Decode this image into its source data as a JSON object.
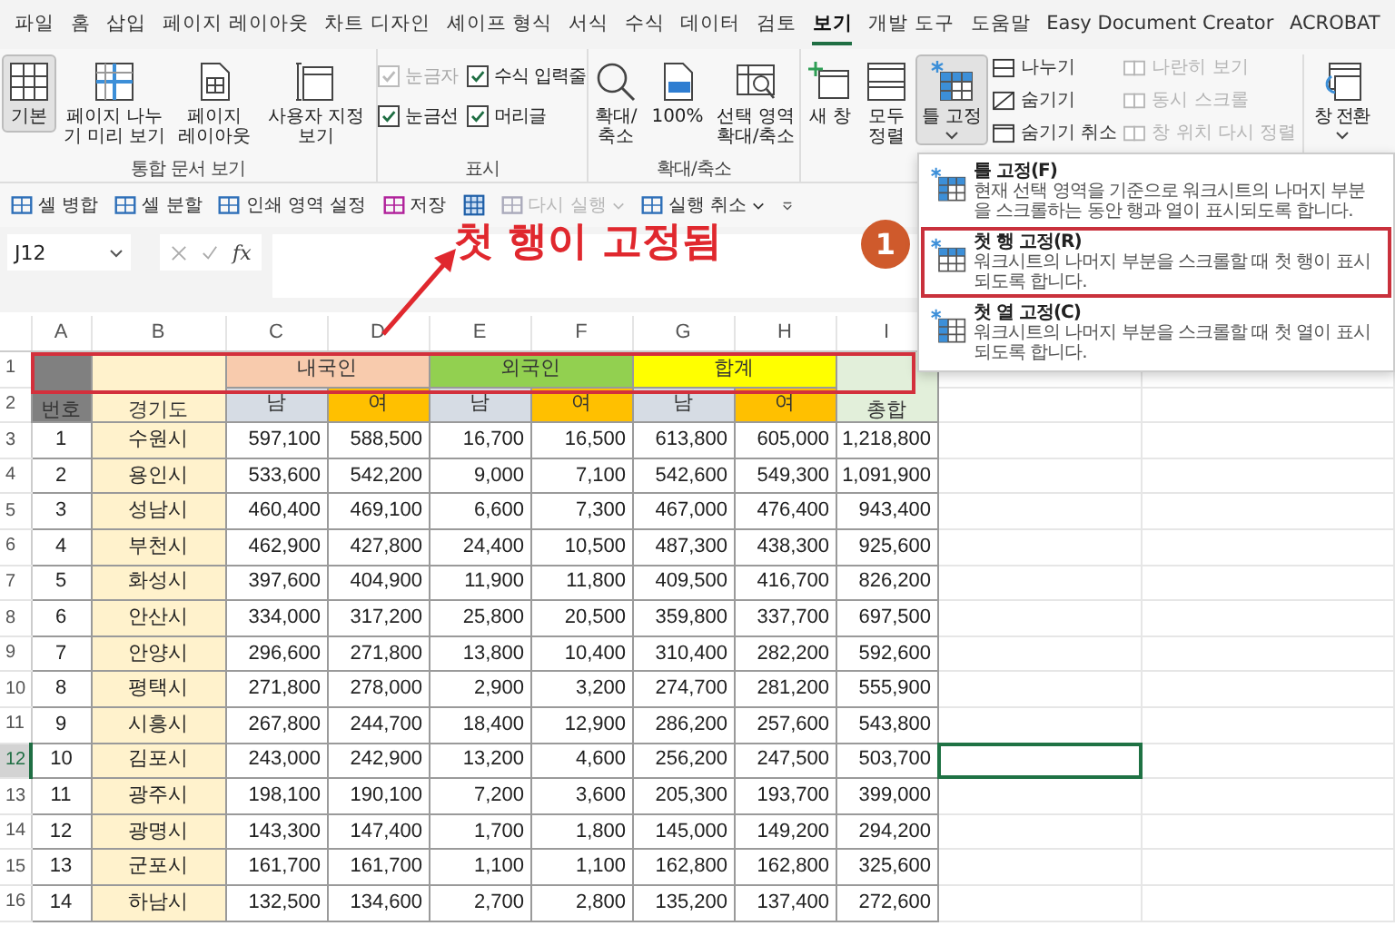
{
  "menu_tabs": [
    {
      "label": "파일",
      "selected": false
    },
    {
      "label": "홈",
      "selected": false
    },
    {
      "label": "삽입",
      "selected": false
    },
    {
      "label": "페이지 레이아웃",
      "selected": false
    },
    {
      "label": "차트 디자인",
      "selected": false
    },
    {
      "label": "셰이프 형식",
      "selected": false
    },
    {
      "label": "서식",
      "selected": false
    },
    {
      "label": "수식",
      "selected": false
    },
    {
      "label": "데이터",
      "selected": false
    },
    {
      "label": "검토",
      "selected": false
    },
    {
      "label": "보기",
      "selected": true
    },
    {
      "label": "개발 도구",
      "selected": false
    },
    {
      "label": "도움말",
      "selected": false
    },
    {
      "label": "Easy Document Creator",
      "selected": false
    },
    {
      "label": "ACROBAT",
      "selected": false
    }
  ],
  "ribbon": {
    "workbook_views": {
      "label": "통합 문서 보기",
      "buttons": [
        {
          "label": "기본",
          "selected": true
        },
        {
          "label": "페이지 나누기 미리 보기",
          "selected": false
        },
        {
          "label": "페이지 레이아웃",
          "selected": false
        },
        {
          "label": "사용자 지정 보기",
          "selected": false
        }
      ]
    },
    "show": {
      "label": "표시",
      "checkboxes": [
        {
          "label": "눈금자",
          "checked": true,
          "disabled": true
        },
        {
          "label": "수식 입력줄",
          "checked": true,
          "disabled": false
        },
        {
          "label": "눈금선",
          "checked": true,
          "disabled": false
        },
        {
          "label": "머리글",
          "checked": true,
          "disabled": false
        }
      ]
    },
    "zoom": {
      "label": "확대/축소",
      "buttons": [
        {
          "label": "확대/축소"
        },
        {
          "label": "100%"
        },
        {
          "label": "선택 영역 확대/축소"
        }
      ]
    },
    "window": {
      "large_buttons": [
        {
          "label": "새 창",
          "pressed": false,
          "dropdown": false
        },
        {
          "label": "모두 정렬",
          "pressed": false,
          "dropdown": false
        },
        {
          "label": "틀 고정",
          "pressed": true,
          "dropdown": true
        }
      ],
      "small_buttons": [
        {
          "label": "나누기",
          "disabled": false
        },
        {
          "label": "숨기기",
          "disabled": false
        },
        {
          "label": "숨기기 취소",
          "disabled": false
        },
        {
          "label": "나란히 보기",
          "disabled": true
        },
        {
          "label": "동시 스크롤",
          "disabled": true
        },
        {
          "label": "창 위치 다시 정렬",
          "disabled": true
        }
      ],
      "switch_button": {
        "label": "창 전환",
        "dropdown": true
      }
    }
  },
  "quick_access": [
    {
      "kind": "labeled",
      "label": "셀 병합",
      "disabled": false,
      "dropdown": false
    },
    {
      "kind": "labeled",
      "label": "셀 분할",
      "disabled": false,
      "dropdown": false
    },
    {
      "kind": "labeled",
      "label": "인쇄 영역 설정",
      "disabled": false,
      "dropdown": false
    },
    {
      "kind": "labeled",
      "label": "저장",
      "disabled": false,
      "dropdown": false
    },
    {
      "kind": "icon"
    },
    {
      "kind": "labeled",
      "label": "다시 실행",
      "disabled": true,
      "dropdown": true
    },
    {
      "kind": "labeled",
      "label": "실행 취소",
      "disabled": false,
      "dropdown": true
    },
    {
      "kind": "customize"
    }
  ],
  "formula_bar": {
    "name_box": "J12",
    "function_label": "fx"
  },
  "sheet": {
    "columns": [
      "A",
      "B",
      "C",
      "D",
      "E",
      "F",
      "G",
      "H",
      "I"
    ],
    "row_numbers": [
      {
        "label": "1",
        "selected": false
      },
      {
        "label": "2",
        "selected": false
      },
      {
        "label": "3",
        "selected": false
      },
      {
        "label": "4",
        "selected": false
      },
      {
        "label": "5",
        "selected": false
      },
      {
        "label": "6",
        "selected": false
      },
      {
        "label": "7",
        "selected": false
      },
      {
        "label": "8",
        "selected": false
      },
      {
        "label": "9",
        "selected": false
      },
      {
        "label": "10",
        "selected": false
      },
      {
        "label": "11",
        "selected": false
      },
      {
        "label": "12",
        "selected": true
      },
      {
        "label": "13",
        "selected": false
      },
      {
        "label": "14",
        "selected": false
      },
      {
        "label": "15",
        "selected": false
      },
      {
        "label": "16",
        "selected": false
      }
    ],
    "header": [
      {
        "kind": "merged",
        "label": "번호",
        "color": "#808080"
      },
      {
        "kind": "merged",
        "label": "경기도",
        "color": "#fff2cc"
      },
      {
        "kind": "split",
        "label": "내국인",
        "color": "#f8cbad",
        "subs": [
          {
            "label": "남",
            "color": "#d6dce4"
          },
          {
            "label": "여",
            "color": "#ffc000"
          }
        ]
      },
      {
        "kind": "split",
        "label": "외국인",
        "color": "#92d050",
        "subs": [
          {
            "label": "남",
            "color": "#d6dce4"
          },
          {
            "label": "여",
            "color": "#ffc000"
          }
        ]
      },
      {
        "kind": "split",
        "label": "합계",
        "color": "#ffff00",
        "subs": [
          {
            "label": "남",
            "color": "#d6dce4"
          },
          {
            "label": "여",
            "color": "#ffc000"
          }
        ]
      },
      {
        "kind": "merged",
        "label": "총합",
        "color": "#e2efda"
      }
    ],
    "rows": [
      {
        "no": "1",
        "city": "수원시",
        "values": [
          "597,100",
          "588,500",
          "16,700",
          "16,500",
          "613,800",
          "605,000",
          "1,218,800"
        ]
      },
      {
        "no": "2",
        "city": "용인시",
        "values": [
          "533,600",
          "542,200",
          "9,000",
          "7,100",
          "542,600",
          "549,300",
          "1,091,900"
        ]
      },
      {
        "no": "3",
        "city": "성남시",
        "values": [
          "460,400",
          "469,100",
          "6,600",
          "7,300",
          "467,000",
          "476,400",
          "943,400"
        ]
      },
      {
        "no": "4",
        "city": "부천시",
        "values": [
          "462,900",
          "427,800",
          "24,400",
          "10,500",
          "487,300",
          "438,300",
          "925,600"
        ]
      },
      {
        "no": "5",
        "city": "화성시",
        "values": [
          "397,600",
          "404,900",
          "11,900",
          "11,800",
          "409,500",
          "416,700",
          "826,200"
        ]
      },
      {
        "no": "6",
        "city": "안산시",
        "values": [
          "334,000",
          "317,200",
          "25,800",
          "20,500",
          "359,800",
          "337,700",
          "697,500"
        ]
      },
      {
        "no": "7",
        "city": "안양시",
        "values": [
          "296,600",
          "271,800",
          "13,800",
          "10,400",
          "310,400",
          "282,200",
          "592,600"
        ]
      },
      {
        "no": "8",
        "city": "평택시",
        "values": [
          "271,800",
          "278,000",
          "2,900",
          "3,200",
          "274,700",
          "281,200",
          "555,900"
        ]
      },
      {
        "no": "9",
        "city": "시흥시",
        "values": [
          "267,800",
          "244,700",
          "18,400",
          "12,900",
          "286,200",
          "257,600",
          "543,800"
        ]
      },
      {
        "no": "10",
        "city": "김포시",
        "values": [
          "243,000",
          "242,900",
          "13,200",
          "4,600",
          "256,200",
          "247,500",
          "503,700"
        ]
      },
      {
        "no": "11",
        "city": "광주시",
        "values": [
          "198,100",
          "190,100",
          "7,200",
          "3,600",
          "205,300",
          "193,700",
          "399,000"
        ]
      },
      {
        "no": "12",
        "city": "광명시",
        "values": [
          "143,300",
          "147,400",
          "1,700",
          "1,800",
          "145,000",
          "149,200",
          "294,200"
        ]
      },
      {
        "no": "13",
        "city": "군포시",
        "values": [
          "161,700",
          "161,700",
          "1,100",
          "1,100",
          "162,800",
          "162,800",
          "325,600"
        ]
      },
      {
        "no": "14",
        "city": "하남시",
        "values": [
          "132,500",
          "134,600",
          "2,700",
          "2,800",
          "135,200",
          "137,400",
          "272,600"
        ]
      }
    ]
  },
  "freeze_menu": {
    "items": [
      {
        "title": "틀 고정(F)",
        "description": "현재 선택 영역을 기준으로 워크시트의 나머지 부분을 스크롤하는 동안 행과 열이 표시되도록 합니다.",
        "highlighted": false
      },
      {
        "title": "첫 행 고정(R)",
        "description": "워크시트의 나머지 부분을 스크롤할 때 첫 행이 표시되도록 합니다.",
        "highlighted": true
      },
      {
        "title": "첫 열 고정(C)",
        "description": "워크시트의 나머지 부분을 스크롤할 때 첫 열이 표시되도록 합니다.",
        "highlighted": false
      }
    ]
  },
  "annotation": {
    "callout": "첫 행이 고정됨",
    "step_badge": "1"
  }
}
